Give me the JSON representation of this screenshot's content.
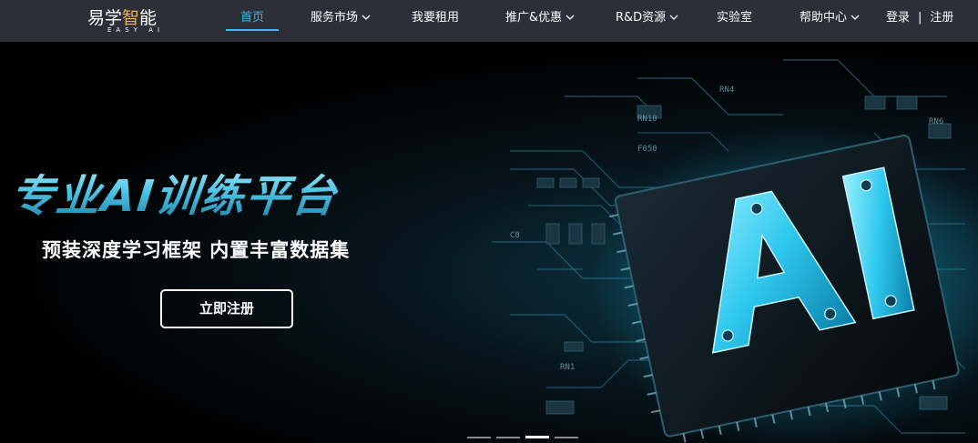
{
  "brand": {
    "logo_text_pre": "易学",
    "logo_text_hl": "智",
    "logo_text_post": "能",
    "logo_sub": "EASY AI"
  },
  "nav": {
    "items": [
      {
        "label": "首页",
        "active": true,
        "dropdown": false
      },
      {
        "label": "服务市场",
        "active": false,
        "dropdown": true
      },
      {
        "label": "我要租用",
        "active": false,
        "dropdown": false
      },
      {
        "label": "推广&优惠",
        "active": false,
        "dropdown": true
      },
      {
        "label": "R&D资源",
        "active": false,
        "dropdown": true
      },
      {
        "label": "实验室",
        "active": false,
        "dropdown": false
      },
      {
        "label": "帮助中心",
        "active": false,
        "dropdown": true
      }
    ],
    "login": "登录",
    "separator": "|",
    "register": "注册"
  },
  "hero": {
    "title": "专业AI训练平台",
    "subtitle": "预装深度学习框架  内置丰富数据集",
    "cta": "立即注册",
    "chip_label": "AI",
    "slides_total": 4,
    "slide_active": 3
  },
  "colors": {
    "nav_bg": "#2c2e38",
    "accent": "#3fb6ea",
    "logo_highlight": "#f2b24a",
    "chip_glow": "#2fc8ee"
  }
}
